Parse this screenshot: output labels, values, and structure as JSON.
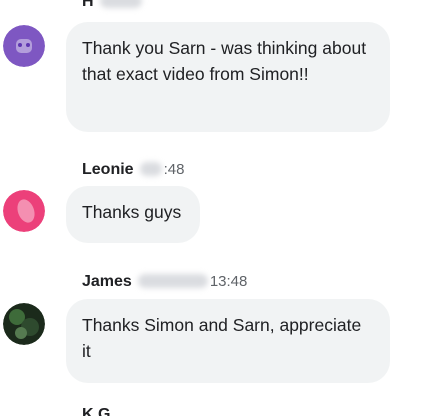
{
  "messages": [
    {
      "sender": "H",
      "time": "",
      "text": "Thank you Sarn - was thinking about that exact video from Simon!!",
      "avatar_color": "#7e57c2"
    },
    {
      "sender": "Leonie",
      "time": ":48",
      "text": "Thanks guys",
      "avatar_color": "#ec407a"
    },
    {
      "sender": "James",
      "time": "13:48",
      "text": "Thanks Simon and Sarn, appreciate it",
      "avatar_color": "#2e4a2e"
    },
    {
      "sender": "K G",
      "time": "",
      "text": "",
      "avatar_color": ""
    }
  ]
}
